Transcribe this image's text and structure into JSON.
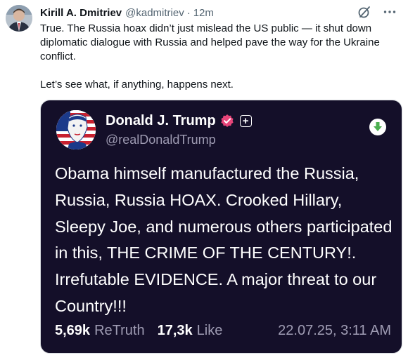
{
  "tweet": {
    "author_name": "Kirill A. Dmitriev",
    "author_handle": "@kadmitriev",
    "separator": "·",
    "time": "12m",
    "text_paragraph_1": "True. The Russia hoax didn’t just mislead the US public — it shut down diplomatic dialogue with Russia and helped pave the way for the Ukraine conflict.",
    "text_paragraph_2": "Let’s see what, if anything, happens next.",
    "icons": [
      "avatar",
      "grok-icon",
      "more-options-icon"
    ]
  },
  "embed": {
    "author_name": "Donald J. Trump",
    "author_handle": "@realDonaldTrump",
    "plus_badge": "+",
    "text": "Obama himself manufactured the Russia, Russia, Russia HOAX. Crooked Hillary, Sleepy Joe, and numerous others participated in this, THE CRIME OF THE CENTURY!. Irrefutable EVIDENCE. A major threat to our Country!!!",
    "retruth_count": "5,69k",
    "retruth_label": "ReTruth",
    "like_count": "17,3k",
    "like_label": "Like",
    "date": "22.07.25, 3:11 AM",
    "icons": [
      "verified-badge-icon",
      "plus-badge-icon",
      "download-icon"
    ]
  },
  "colors": {
    "card_background": "#140f29",
    "muted_text": "#9f9cb3",
    "verified_pink": "#e8457a",
    "download_green": "#4caf50",
    "x_muted": "#536471"
  }
}
